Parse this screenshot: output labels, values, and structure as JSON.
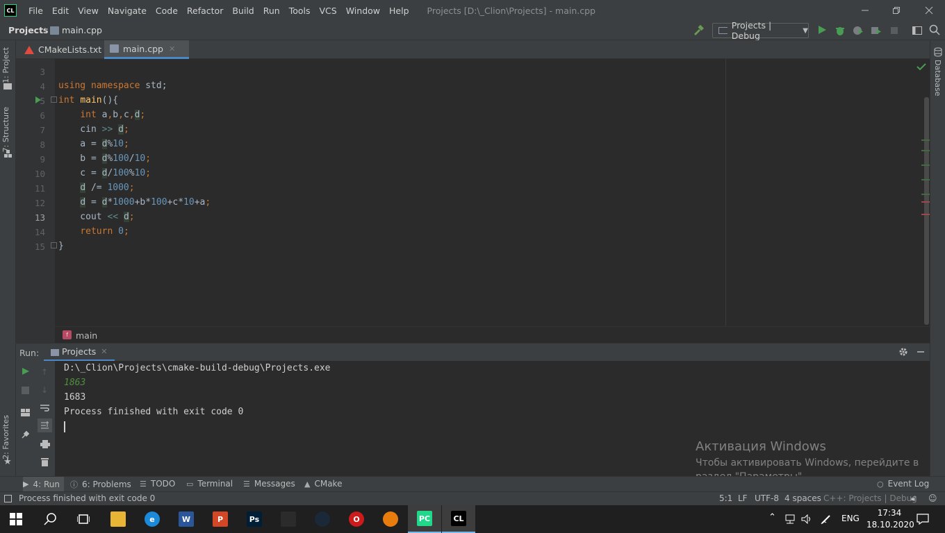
{
  "window": {
    "logo": "CL",
    "menu": [
      "File",
      "Edit",
      "View",
      "Navigate",
      "Code",
      "Refactor",
      "Build",
      "Run",
      "Tools",
      "VCS",
      "Window",
      "Help"
    ],
    "title": "Projects [D:\\_Clion\\Projects] - main.cpp"
  },
  "navbar": {
    "project": "Projects",
    "file": "main.cpp",
    "run_config": "Projects | Debug"
  },
  "left_stripe": {
    "project_tab": "1: Project",
    "structure_tab": "7: Structure",
    "favorites_tab": "2: Favorites"
  },
  "right_stripe": {
    "database_tab": "Database"
  },
  "tabs": [
    {
      "label": "CMakeLists.txt"
    },
    {
      "label": "main.cpp"
    }
  ],
  "editor": {
    "current_line": "13",
    "lines": [
      {
        "n": "3",
        "html": ""
      },
      {
        "n": "4",
        "html": "<span style='color:#cc7832'>using namespace</span> std;"
      },
      {
        "n": "5",
        "html": "<span style='color:#cc7832'>int</span> <span style='color:#ffc66d'>main</span>(){"
      },
      {
        "n": "6",
        "html": "    <span style='color:#cc7832'>int</span> a<span style='color:#cc7832'>,</span>b<span style='color:#cc7832'>,</span>c<span style='color:#cc7832'>,</span><span style='background:#344134'>d</span><span style='color:#cc7832'>;</span>"
      },
      {
        "n": "7",
        "html": "    cin <span style='color:#5f8c8a'>&gt;&gt;</span> <span style='background:#344134'>d</span><span style='color:#cc7832'>;</span>"
      },
      {
        "n": "8",
        "html": "    a = <span style='background:#344134'>d</span>%<span style='color:#6897bb'>10</span><span style='color:#cc7832'>;</span>"
      },
      {
        "n": "9",
        "html": "    b = <span style='background:#344134'>d</span>%<span style='color:#6897bb'>100</span>/<span style='color:#6897bb'>10</span><span style='color:#cc7832'>;</span>"
      },
      {
        "n": "10",
        "html": "    c = <span style='background:#344134'>d</span>/<span style='color:#6897bb'>100</span>%<span style='color:#6897bb'>10</span><span style='color:#cc7832'>;</span>"
      },
      {
        "n": "11",
        "html": "    <span style='background:#344134'>d</span> /= <span style='color:#6897bb'>1000</span><span style='color:#cc7832'>;</span>"
      },
      {
        "n": "12",
        "html": "    <span style='background:#344134'>d</span> = <span style='background:#344134'>d</span>*<span style='color:#6897bb'>1000</span>+b*<span style='color:#6897bb'>100</span>+c*<span style='color:#6897bb'>10</span>+a<span style='color:#cc7832'>;</span>"
      },
      {
        "n": "13",
        "html": "    cout <span style='color:#5f8c8a'>&lt;&lt;</span> <span style='background:#344134'>d</span><span style='color:#cc7832'>;</span>"
      },
      {
        "n": "14",
        "html": "    <span style='color:#cc7832'>return</span> <span style='color:#6897bb'>0</span><span style='color:#cc7832'>;</span>"
      },
      {
        "n": "15",
        "html": "}"
      }
    ],
    "breadcrumb_icon": "f",
    "breadcrumb": "main"
  },
  "run_panel": {
    "label": "Run:",
    "tab": "Projects",
    "console": [
      {
        "text": "D:\\_Clion\\Projects\\cmake-build-debug\\Projects.exe",
        "color": "#d0d0d0",
        "italic": false
      },
      {
        "text": "1863",
        "color": "#4f8f3e",
        "italic": true
      },
      {
        "text": "1683",
        "color": "#d0d0d0",
        "italic": false
      },
      {
        "text": "Process finished with exit code 0",
        "color": "#d0d0d0",
        "italic": false
      }
    ]
  },
  "tool_tabs": {
    "run": "4: Run",
    "problems": "6: Problems",
    "todo": "TODO",
    "terminal": "Terminal",
    "messages": "Messages",
    "cmake": "CMake",
    "event_log": "Event Log"
  },
  "statusbar": {
    "message": "Process finished with exit code 0",
    "position": "5:1",
    "line_sep": "LF",
    "encoding": "UTF-8",
    "indent": "4 spaces",
    "context": "C++: Projects | Debug"
  },
  "watermark": {
    "title": "Активация Windows",
    "text": "Чтобы активировать Windows, перейдите в раздел \"Параметры\"."
  },
  "taskbar": {
    "lang": "ENG",
    "time": "17:34",
    "date": "18.10.2020",
    "apps": [
      {
        "name": "explorer",
        "label": "",
        "color": "#e8b534"
      },
      {
        "name": "edge",
        "label": "e",
        "color": "#1b8ad8"
      },
      {
        "name": "word",
        "label": "W",
        "color": "#2b579a"
      },
      {
        "name": "powerpoint",
        "label": "P",
        "color": "#d24726"
      },
      {
        "name": "photoshop",
        "label": "Ps",
        "color": "#001e36"
      },
      {
        "name": "inkscape",
        "label": "",
        "color": "#2b2b2b"
      },
      {
        "name": "steam",
        "label": "",
        "color": "#1b2838"
      },
      {
        "name": "opera",
        "label": "O",
        "color": "#cc1b1b"
      },
      {
        "name": "blender",
        "label": "",
        "color": "#e87d0d"
      },
      {
        "name": "pycharm",
        "label": "PC",
        "color": "#21d789"
      },
      {
        "name": "clion",
        "label": "CL",
        "color": "#000000"
      }
    ]
  },
  "colors": {
    "accent": "#4a88c7",
    "run_green": "#499c54",
    "editor_bg": "#2b2b2b",
    "panel_bg": "#3c3f41"
  }
}
